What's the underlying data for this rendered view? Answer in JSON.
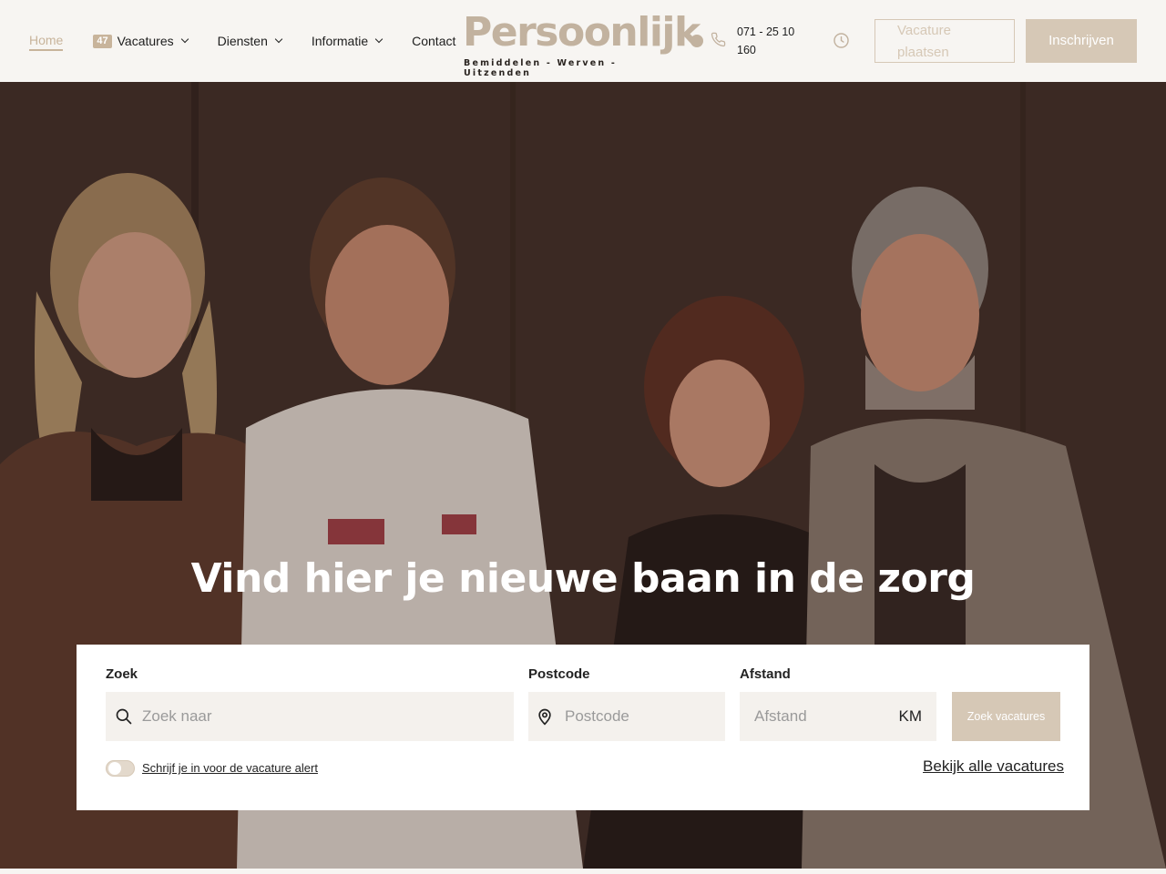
{
  "nav": {
    "items": [
      {
        "label": "Home",
        "active": true
      },
      {
        "label": "Vacatures",
        "badge": "47",
        "dropdown": true
      },
      {
        "label": "Diensten",
        "dropdown": true
      },
      {
        "label": "Informatie",
        "dropdown": true
      },
      {
        "label": "Contact"
      }
    ]
  },
  "logo": {
    "name": "Persoonlijk",
    "tagline": "Bemiddelen - Werven - Uitzenden"
  },
  "contact": {
    "phone": "071 - 25 10 160"
  },
  "header_buttons": {
    "post_vacancy": "Vacature plaatsen",
    "register": "Inschrijven"
  },
  "hero": {
    "title": "Vind hier je nieuwe baan in de zorg"
  },
  "search": {
    "query_label": "Zoek",
    "query_placeholder": "Zoek naar",
    "postcode_label": "Postcode",
    "postcode_placeholder": "Postcode",
    "distance_label": "Afstand",
    "distance_placeholder": "Afstand",
    "distance_unit": "KM",
    "submit_label": "Zoek vacatures",
    "alert_label": "Schrijf je in voor de vacature alert",
    "all_link": "Bekijk alle vacatures"
  },
  "colors": {
    "accent": "#c8b49b",
    "button": "#d6c8b6",
    "header_bg": "#f7f5f2",
    "hero_bg": "#3a2b26"
  },
  "icons": [
    "chevron-down-icon",
    "phone-icon",
    "clock-icon",
    "search-icon",
    "location-pin-icon"
  ]
}
